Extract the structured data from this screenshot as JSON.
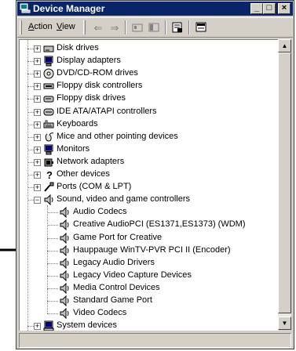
{
  "window": {
    "title": "Device Manager",
    "controls": {
      "minimize": "_",
      "maximize": "□",
      "close": "×"
    }
  },
  "toolbar": {
    "menus": [
      {
        "label": "Action",
        "accel": "A"
      },
      {
        "label": "View",
        "accel": "V"
      }
    ],
    "buttons": [
      "back-icon",
      "forward-icon",
      "up-folder-icon",
      "show-hide-console-tree-icon",
      "properties-icon",
      "help-icon"
    ]
  },
  "tree": {
    "items": [
      {
        "label": "Disk drives",
        "icon": "disk-drive-icon",
        "level": 1,
        "expander": "+"
      },
      {
        "label": "Display adapters",
        "icon": "monitor-icon",
        "level": 1,
        "expander": "+"
      },
      {
        "label": "DVD/CD-ROM drives",
        "icon": "cdrom-icon",
        "level": 1,
        "expander": "+"
      },
      {
        "label": "Floppy disk controllers",
        "icon": "controller-icon",
        "level": 1,
        "expander": "+"
      },
      {
        "label": "Floppy disk drives",
        "icon": "floppy-icon",
        "level": 1,
        "expander": "+"
      },
      {
        "label": "IDE ATA/ATAPI controllers",
        "icon": "ide-controller-icon",
        "level": 1,
        "expander": "+"
      },
      {
        "label": "Keyboards",
        "icon": "keyboard-icon",
        "level": 1,
        "expander": "+"
      },
      {
        "label": "Mice and other pointing devices",
        "icon": "mouse-icon",
        "level": 1,
        "expander": "+"
      },
      {
        "label": "Monitors",
        "icon": "monitor-icon",
        "level": 1,
        "expander": "+"
      },
      {
        "label": "Network adapters",
        "icon": "network-adapter-icon",
        "level": 1,
        "expander": "+"
      },
      {
        "label": "Other devices",
        "icon": "question-device-icon",
        "level": 1,
        "expander": "+"
      },
      {
        "label": "Ports (COM & LPT)",
        "icon": "port-icon",
        "level": 1,
        "expander": "+"
      },
      {
        "label": "Sound, video and game controllers",
        "icon": "speaker-icon",
        "level": 1,
        "expander": "−"
      },
      {
        "label": "Audio Codecs",
        "icon": "speaker-icon",
        "level": 2
      },
      {
        "label": "Creative AudioPCI (ES1371,ES1373) (WDM)",
        "icon": "speaker-icon",
        "level": 2
      },
      {
        "label": "Game Port for Creative",
        "icon": "speaker-icon",
        "level": 2
      },
      {
        "label": "Hauppauge WinTV-PVR PCI II (Encoder)",
        "icon": "speaker-icon",
        "level": 2
      },
      {
        "label": "Legacy Audio Drivers",
        "icon": "speaker-icon",
        "level": 2
      },
      {
        "label": "Legacy Video Capture Devices",
        "icon": "speaker-icon",
        "level": 2
      },
      {
        "label": "Media Control Devices",
        "icon": "speaker-icon",
        "level": 2
      },
      {
        "label": "Standard Game Port",
        "icon": "speaker-icon",
        "level": 2
      },
      {
        "label": "Video Codecs",
        "icon": "speaker-icon",
        "level": 2
      },
      {
        "label": "System devices",
        "icon": "computer-icon",
        "level": 1,
        "expander": "+"
      }
    ]
  },
  "colors": {
    "titlebar": "#0a246a",
    "face": "#d4d0c8",
    "arrow": "#000000"
  }
}
